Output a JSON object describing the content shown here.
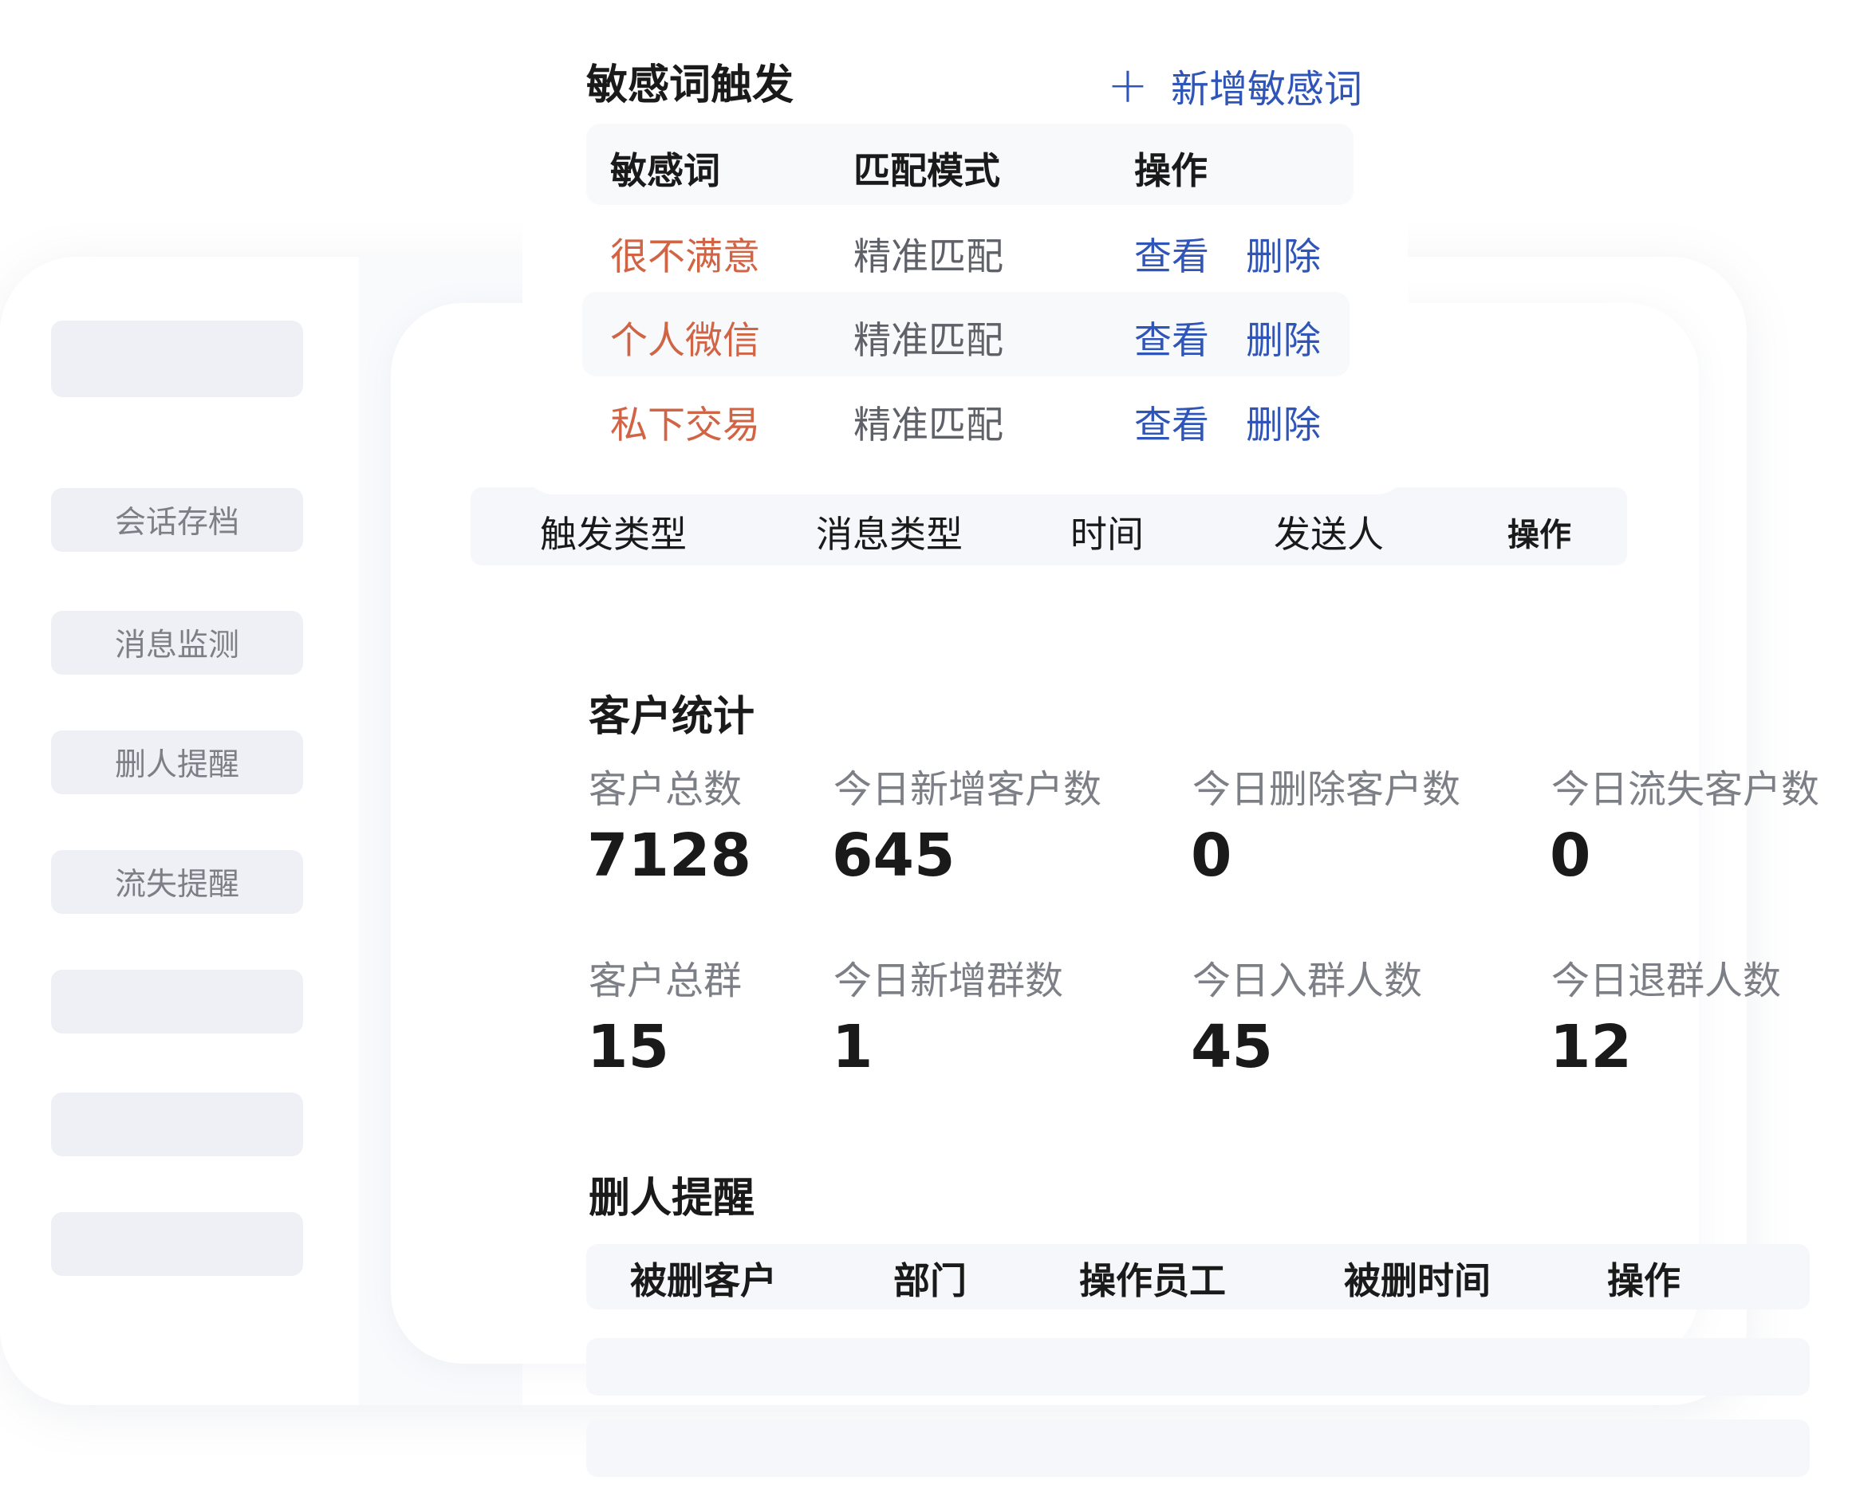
{
  "sidebar": {
    "items": [
      {
        "label": ""
      },
      {
        "label": "会话存档"
      },
      {
        "label": "消息监测"
      },
      {
        "label": "删人提醒"
      },
      {
        "label": "流失提醒"
      },
      {
        "label": ""
      },
      {
        "label": ""
      },
      {
        "label": ""
      }
    ]
  },
  "sensitive_words": {
    "title": "敏感词触发",
    "add_button": "新增敏感词",
    "add_icon": "plus-icon",
    "columns": [
      "敏感词",
      "匹配模式",
      "操作"
    ],
    "rows": [
      {
        "word": "很不满意",
        "mode": "精准匹配",
        "view": "查看",
        "delete": "删除"
      },
      {
        "word": "个人微信",
        "mode": "精准匹配",
        "view": "查看",
        "delete": "删除"
      },
      {
        "word": "私下交易",
        "mode": "精准匹配",
        "view": "查看",
        "delete": "删除"
      }
    ]
  },
  "detection_table": {
    "columns": [
      "触发类型",
      "消息类型",
      "时间",
      "发送人",
      "操作"
    ]
  },
  "customer_stats": {
    "title": "客户统计",
    "items": [
      {
        "label": "客户总数",
        "value": "7128"
      },
      {
        "label": "今日新增客户数",
        "value": "645"
      },
      {
        "label": "今日删除客户数",
        "value": "0"
      },
      {
        "label": "今日流失客户数",
        "value": "0"
      },
      {
        "label": "客户总群",
        "value": "15"
      },
      {
        "label": "今日新增群数",
        "value": "1"
      },
      {
        "label": "今日入群人数",
        "value": "45"
      },
      {
        "label": "今日退群人数",
        "value": "12"
      }
    ]
  },
  "delete_reminder": {
    "title": "删人提醒",
    "columns": [
      "被删客户",
      "部门",
      "操作员工",
      "被删时间",
      "操作"
    ]
  },
  "colors": {
    "accent": "#2f55b8",
    "warning_word": "#d26446",
    "muted_text": "#7d7f86",
    "placeholder_bg": "#eff0f5"
  }
}
